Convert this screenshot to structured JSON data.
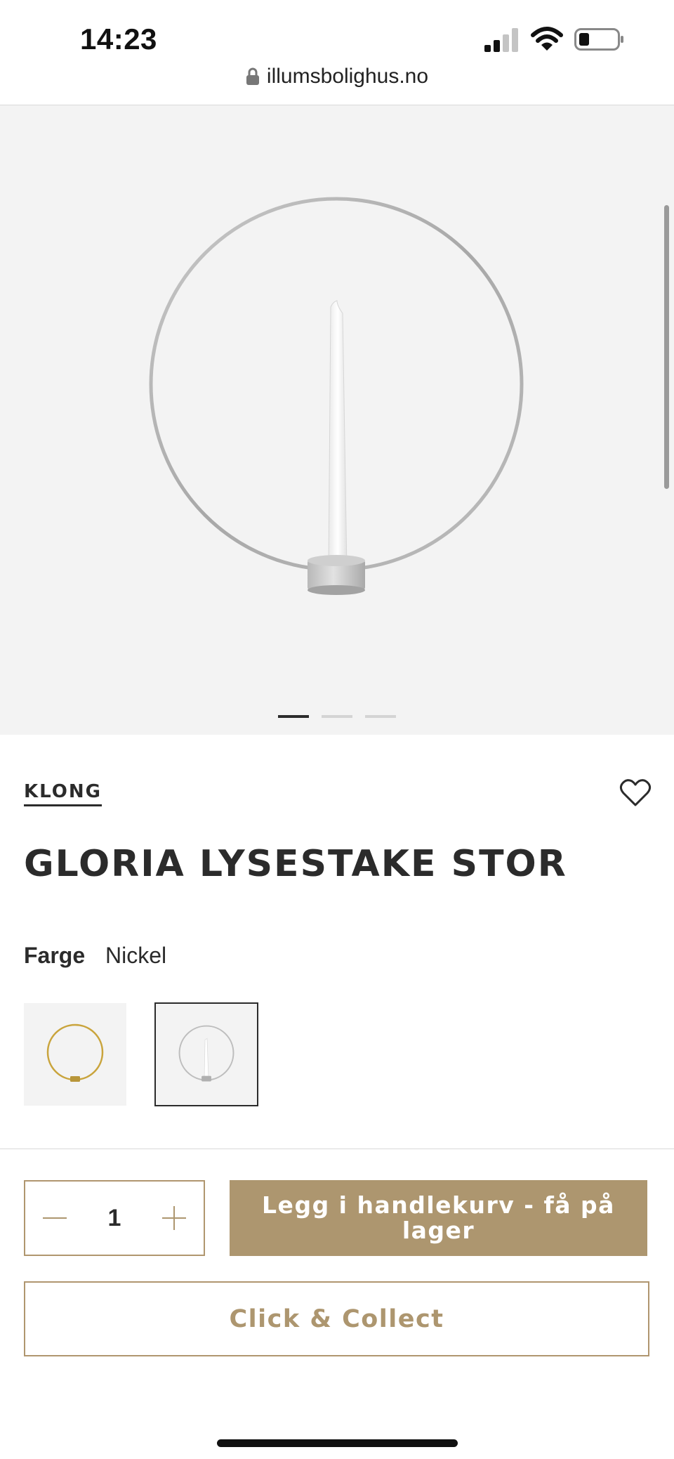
{
  "status_bar": {
    "time": "14:23"
  },
  "browser": {
    "url": "illumsbolighus.no"
  },
  "gallery": {
    "slides": 3,
    "active_slide": 1
  },
  "product": {
    "brand": "KLONG",
    "title": "GLORIA LYSESTAKE STOR",
    "color_label": "Farge",
    "color_value": "Nickel",
    "variants": [
      {
        "name": "gold-variant",
        "selected": false
      },
      {
        "name": "nickel-variant",
        "selected": true
      }
    ]
  },
  "purchase": {
    "quantity": "1",
    "add_to_cart_label": "Legg i handlekurv - få på lager",
    "click_collect_label": "Click & Collect"
  },
  "icons": [
    "lock-icon",
    "signal-icon",
    "wifi-icon",
    "battery-icon",
    "heart-icon",
    "minus-icon",
    "plus-icon"
  ],
  "colors": {
    "accent": "#ad966f",
    "text": "#2b2b2b",
    "gallery_bg": "#f3f3f3"
  }
}
